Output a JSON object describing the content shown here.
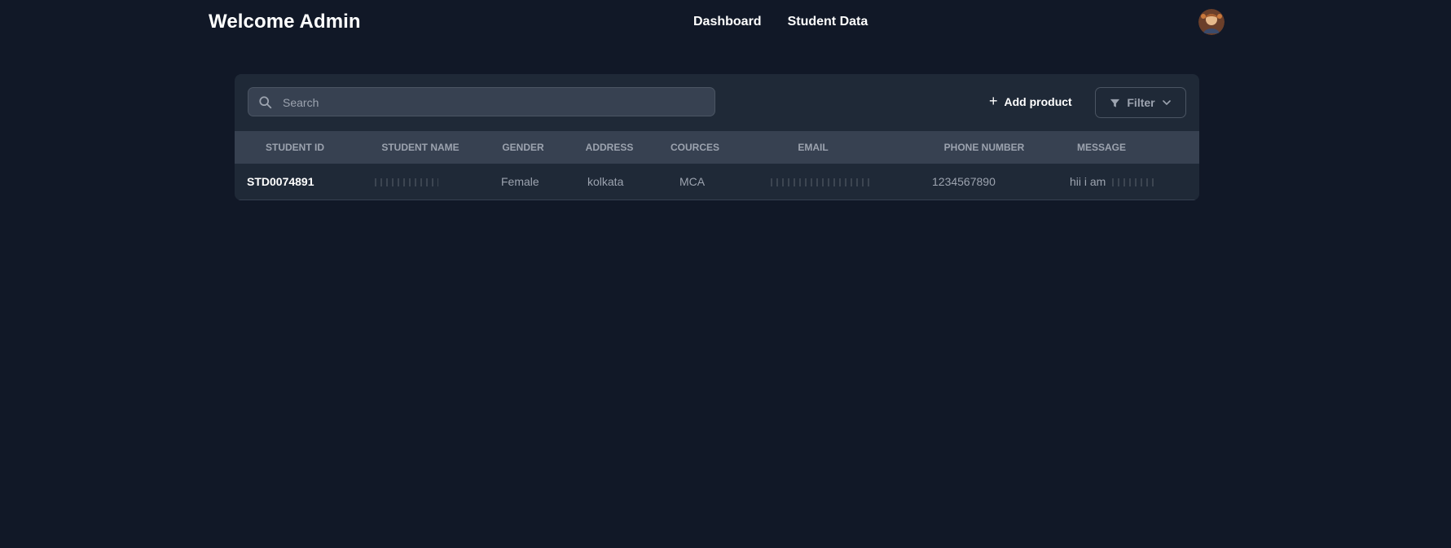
{
  "header": {
    "brand": "Welcome Admin",
    "nav": [
      "Dashboard",
      "Student Data"
    ]
  },
  "toolbar": {
    "search_placeholder": "Search",
    "search_value": "",
    "add_label": "Add product",
    "filter_label": "Filter"
  },
  "table": {
    "columns": [
      "STUDENT ID",
      "STUDENT NAME",
      "GENDER",
      "ADDRESS",
      "COURCES",
      "EMAIL",
      "PHONE NUMBER",
      "MESSAGE"
    ],
    "rows": [
      {
        "id": "STD0074891",
        "gender": "Female",
        "address": "kolkata",
        "course": "MCA",
        "phone": "1234567890",
        "message": "hii i am"
      }
    ]
  },
  "colors": {
    "background": "#111827",
    "panel": "#1f2937",
    "table_header": "#374151",
    "text_primary": "#ffffff",
    "text_muted": "#9ca3af"
  },
  "icons": [
    "search-icon",
    "plus-icon",
    "filter-icon",
    "chevron-down-icon",
    "avatar"
  ]
}
